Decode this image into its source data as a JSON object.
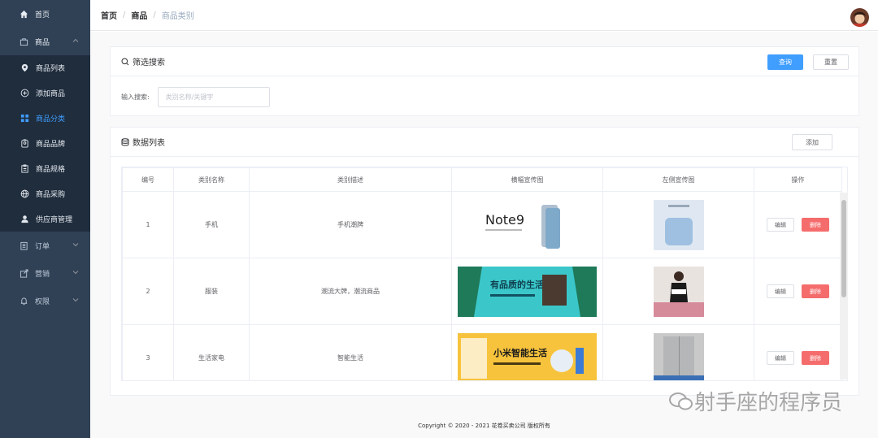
{
  "sidebar": {
    "home": "首页",
    "goods": "商品",
    "goods_sub": [
      {
        "label": "商品列表",
        "icon": "location-pin-icon"
      },
      {
        "label": "添加商品",
        "icon": "plus-circle-icon"
      },
      {
        "label": "商品分类",
        "icon": "grid-icon",
        "active": true
      },
      {
        "label": "商品品牌",
        "icon": "badge-icon"
      },
      {
        "label": "商品规格",
        "icon": "clipboard-icon"
      },
      {
        "label": "商品采购",
        "icon": "globe-icon"
      },
      {
        "label": "供应商管理",
        "icon": "user-icon"
      }
    ],
    "orders": "订单",
    "marketing": "营销",
    "permissions": "权限"
  },
  "breadcrumb": {
    "first": "首页",
    "second": "商品",
    "third": "商品类别"
  },
  "filter": {
    "title": "筛选搜索",
    "query_btn": "查询",
    "reset_btn": "重置",
    "label": "输入搜索:",
    "placeholder": "类别名称/关键字"
  },
  "list": {
    "title": "数据列表",
    "add_btn": "添加",
    "columns": [
      "编号",
      "类别名称",
      "类别描述",
      "横幅宣传图",
      "左侧宣传图",
      "操作"
    ],
    "rows": [
      {
        "id": "1",
        "name": "手机",
        "desc": "手机潮牌"
      },
      {
        "id": "2",
        "name": "服装",
        "desc": "潮流大牌，潮流商品"
      },
      {
        "id": "3",
        "name": "生活家电",
        "desc": "智能生活"
      }
    ],
    "edit_label": "编辑",
    "delete_label": "删除",
    "banner1_text": "Note9",
    "banner2_text": "有品质的生活",
    "banner3_text": "小米智能生活"
  },
  "footer": "Copyright © 2020 - 2021  花卷买卖公司 版权所有",
  "watermark": "射手座的程序员",
  "colors": {
    "sidebar": "#304156",
    "submenu": "#1f2d3d",
    "primary": "#409eff",
    "danger": "#f56c6c"
  }
}
